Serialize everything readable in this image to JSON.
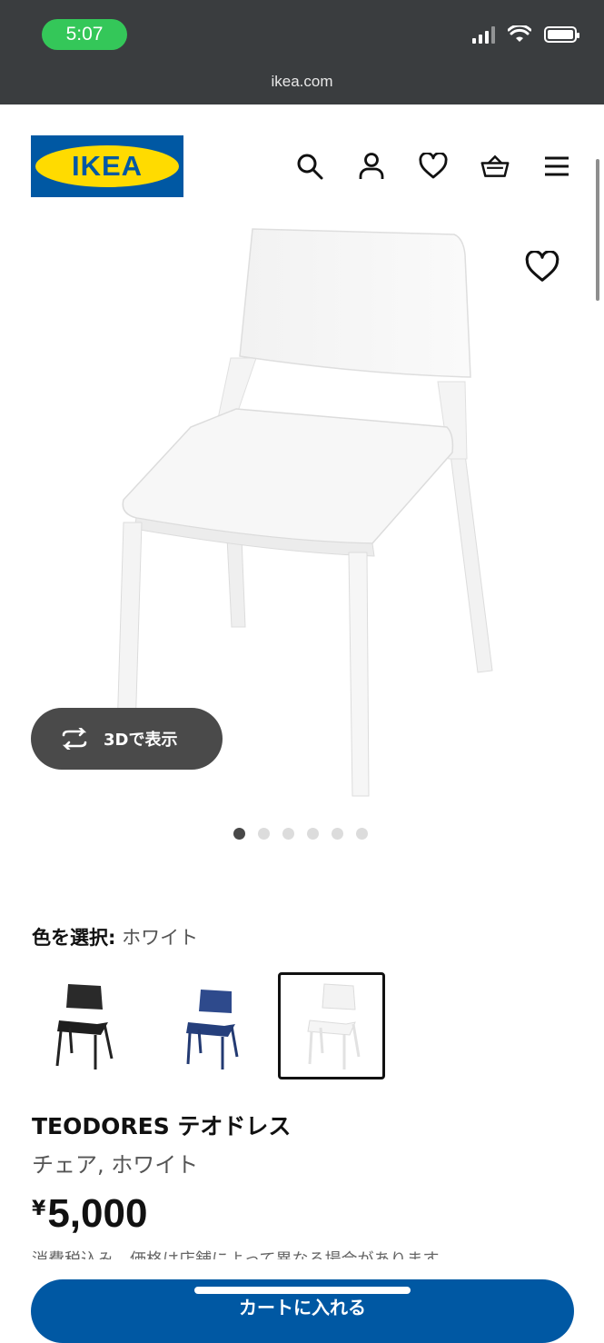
{
  "status_bar": {
    "time": "5:07"
  },
  "browser": {
    "url": "ikea.com"
  },
  "header": {
    "logo_text": "IKEA",
    "icons": [
      "search-icon",
      "account-icon",
      "heart-icon",
      "cart-icon",
      "menu-icon"
    ]
  },
  "product": {
    "view_3d_label": "3Dで表示",
    "image_count": 6,
    "active_image": 1,
    "color_label": "色を選択:",
    "color_value": "ホワイト",
    "swatch_colors": [
      "black",
      "blue",
      "white"
    ],
    "selected_swatch": "white",
    "name": "TEODORES テオドレス",
    "description": "チェア, ホワイト",
    "currency": "¥",
    "price": "5,000",
    "tax_note": "消費税込み。価格は店舗によって異なる場合があります。",
    "add_to_cart_label": "カートに入れる"
  },
  "colors": {
    "ikea_blue": "#0058a3",
    "ikea_yellow": "#ffdb00",
    "status_green": "#34c759"
  }
}
